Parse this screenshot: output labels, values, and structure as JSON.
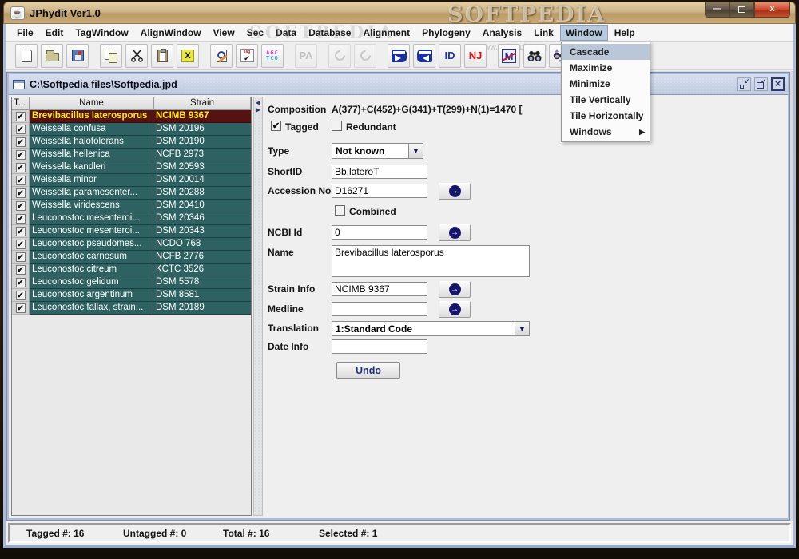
{
  "titlebar": {
    "title": "JPhydit Ver1.0"
  },
  "watermarks": {
    "titlebar": "SOFTPEDIA",
    "menubar": "SOFTPEDIA",
    "toolbar": "www.softpedia.com"
  },
  "window_controls": {
    "minimize": "—",
    "close": "x"
  },
  "menubar": {
    "items": [
      "File",
      "Edit",
      "TagWindow",
      "AlignWindow",
      "View",
      "Sec",
      "Data",
      "Database",
      "Alignment",
      "Phylogeny",
      "Analysis",
      "Link",
      "Window",
      "Help"
    ],
    "active_item": "Window"
  },
  "window_menu": {
    "items": [
      {
        "label": "Cascade",
        "highlighted": true
      },
      {
        "label": "Maximize"
      },
      {
        "label": "Minimize"
      },
      {
        "label": "Tile Vertically"
      },
      {
        "label": "Tile Horizontally"
      },
      {
        "label": "Windows",
        "has_submenu": true
      }
    ]
  },
  "document_window": {
    "title": "C:\\Softpedia files\\Softpedia.jpd"
  },
  "table": {
    "columns": [
      "T...",
      "Name",
      "Strain"
    ],
    "rows": [
      {
        "tagged": true,
        "name": "Brevibacillus laterosporus",
        "strain": "NCIMB 9367",
        "selected": true
      },
      {
        "tagged": true,
        "name": "Weissella confusa",
        "strain": "DSM 20196"
      },
      {
        "tagged": true,
        "name": "Weissella halotolerans",
        "strain": "DSM 20190"
      },
      {
        "tagged": true,
        "name": "Weissella hellenica",
        "strain": "NCFB 2973"
      },
      {
        "tagged": true,
        "name": "Weissella kandleri",
        "strain": "DSM 20593"
      },
      {
        "tagged": true,
        "name": "Weissella minor",
        "strain": "DSM 20014"
      },
      {
        "tagged": true,
        "name": "Weissella paramesenter...",
        "strain": "DSM 20288"
      },
      {
        "tagged": true,
        "name": "Weissella viridescens",
        "strain": "DSM 20410"
      },
      {
        "tagged": true,
        "name": "Leuconostoc mesenteroi...",
        "strain": "DSM 20346"
      },
      {
        "tagged": true,
        "name": "Leuconostoc mesenteroi...",
        "strain": "DSM 20343"
      },
      {
        "tagged": true,
        "name": "Leuconostoc pseudomes...",
        "strain": "NCDO 768"
      },
      {
        "tagged": true,
        "name": "Leuconostoc carnosum",
        "strain": "NCFB 2776"
      },
      {
        "tagged": true,
        "name": "Leuconostoc citreum",
        "strain": "KCTC 3526"
      },
      {
        "tagged": true,
        "name": "Leuconostoc gelidum",
        "strain": "DSM 5578"
      },
      {
        "tagged": true,
        "name": "Leuconostoc argentinum",
        "strain": "DSM 8581"
      },
      {
        "tagged": true,
        "name": "Leuconostoc fallax, strain...",
        "strain": "DSM 20189"
      }
    ]
  },
  "form": {
    "composition_label": "Composition",
    "composition_value": "A(377)+C(452)+G(341)+T(299)+N(1)=1470 [",
    "tagged_label": "Tagged",
    "redundant_label": "Redundant",
    "type_label": "Type",
    "type_value": "Not known",
    "shortid_label": "ShortID",
    "shortid_value": "Bb.lateroT",
    "accession_label": "Accession No",
    "accession_value": "D16271",
    "combined_label": "Combined",
    "ncbi_label": "NCBI Id",
    "ncbi_value": "0",
    "name_label": "Name",
    "name_value": "Brevibacillus laterosporus",
    "strain_label": "Strain Info",
    "strain_value": "NCIMB 9367",
    "medline_label": "Medline",
    "medline_value": "",
    "translation_label": "Translation",
    "translation_value": "1:Standard Code",
    "dateinfo_label": "Date Info",
    "dateinfo_value": "",
    "undo_label": "Undo"
  },
  "status_bar": {
    "tagged": "Tagged #: 16",
    "untagged": "Untagged #: 0",
    "total": "Total #: 16",
    "selected": "Selected #: 1"
  },
  "icons": {
    "java-icon": "☕",
    "check-icon": "✔",
    "combo-arrow-icon": "▼",
    "submenu-arrow-icon": "▶",
    "go-arrow-icon": "→",
    "splitter-left-icon": "◀",
    "splitter-right-icon": "▶",
    "restore-arrow-icon": "↙",
    "close-x-icon": "×",
    "delete-x-icon": "X",
    "tag-icon": "Tag",
    "pa-icon": "PA",
    "id-icon": "ID",
    "nj-icon": "NJ",
    "model-m-icon": "M",
    "seq-row1": "AGC",
    "seq-row2": "TCO"
  },
  "colors": {
    "row_teal": "#2e6161",
    "row_selected_bg": "#561111",
    "row_selected_text": "#ffec00",
    "accent_navy": "#16166b",
    "menu_highlight": "#b7c9dc",
    "child_titlebar": "#c9d2e7",
    "titlebar_tan": "#cdb386"
  }
}
